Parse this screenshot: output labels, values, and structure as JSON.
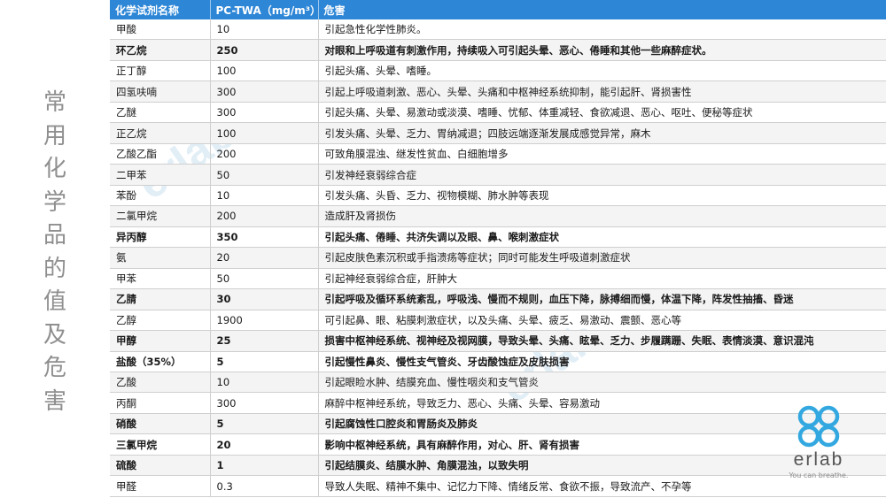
{
  "side_title": [
    "常",
    "用",
    "化",
    "学",
    "品",
    "的",
    "值",
    "及",
    "危",
    "害"
  ],
  "table": {
    "headers": [
      "化学试剂名称",
      "PC-TWA（mg/m³）",
      "危害"
    ],
    "rows": [
      {
        "name": "甲酸",
        "value": "10",
        "hazard": "引起急性化学性肺炎。",
        "bold": false
      },
      {
        "name": "环乙烷",
        "value": "250",
        "hazard": "对眼和上呼吸道有刺激作用，持续吸入可引起头晕、恶心、倦睡和其他一些麻醉症状。",
        "bold": true
      },
      {
        "name": "正丁醇",
        "value": "100",
        "hazard": "引起头痛、头晕、嗜睡。",
        "bold": false
      },
      {
        "name": "四氢呋喃",
        "value": "300",
        "hazard": "引起上呼吸道刺激、恶心、头晕、头痛和中枢神经系统抑制，能引起肝、肾损害性",
        "bold": false
      },
      {
        "name": "乙醚",
        "value": "300",
        "hazard": "引起头痛、头晕、易激动或淡漠、嗜睡、忧郁、体重减轻、食欲减退、恶心、呕吐、便秘等症状",
        "bold": false
      },
      {
        "name": "正乙烷",
        "value": "100",
        "hazard": "引发头痛、头晕、乏力、胃纳减退；四肢远端逐渐发展成感觉异常，麻木",
        "bold": false
      },
      {
        "name": "乙酸乙酯",
        "value": "200",
        "hazard": "可致角膜混浊、继发性贫血、白细胞增多",
        "bold": false
      },
      {
        "name": "二甲苯",
        "value": "50",
        "hazard": "引发神经衰弱综合症",
        "bold": false
      },
      {
        "name": "苯酚",
        "value": "10",
        "hazard": "引发头痛、头昏、乏力、视物模糊、肺水肿等表现",
        "bold": false
      },
      {
        "name": "二氯甲烷",
        "value": "200",
        "hazard": "造成肝及肾损伤",
        "bold": false
      },
      {
        "name": "异丙醇",
        "value": "350",
        "hazard": "引起头痛、倦睡、共济失调以及眼、鼻、喉刺激症状",
        "bold": true
      },
      {
        "name": "氨",
        "value": "20",
        "hazard": "引起皮肤色素沉积或手指溃疡等症状；同时可能发生呼吸道刺激症状",
        "bold": false
      },
      {
        "name": "甲苯",
        "value": "50",
        "hazard": "引起神经衰弱综合症，肝肿大",
        "bold": false
      },
      {
        "name": "乙腈",
        "value": "30",
        "hazard": "引起呼吸及循环系统紊乱，呼吸浅、慢而不规则，血压下降，脉搏细而慢，体温下降，阵发性抽搐、昏迷",
        "bold": true
      },
      {
        "name": "乙醇",
        "value": "1900",
        "hazard": "可引起鼻、眼、粘膜刺激症状，以及头痛、头晕、疲乏、易激动、震颤、恶心等",
        "bold": false
      },
      {
        "name": "甲醇",
        "value": "25",
        "hazard": "损害中枢神经系统、视神经及视网膜，导致头晕、头痛、眩晕、乏力、步履蹒跚、失眠、表情淡漠、意识混沌",
        "bold": true
      },
      {
        "name": "盐酸（35%）",
        "value": "5",
        "hazard": "引起慢性鼻炎、慢性支气管炎、牙齿酸蚀症及皮肤损害",
        "bold": true
      },
      {
        "name": "乙酸",
        "value": "10",
        "hazard": "引起眼睑水肿、结膜充血、慢性咽炎和支气管炎",
        "bold": false
      },
      {
        "name": "丙酮",
        "value": "300",
        "hazard": "麻醉中枢神经系统，导致乏力、恶心、头痛、头晕、容易激动",
        "bold": false
      },
      {
        "name": "硝酸",
        "value": "5",
        "hazard": "引起腐蚀性口腔炎和胃肠炎及肺炎",
        "bold": true
      },
      {
        "name": "三氯甲烷",
        "value": "20",
        "hazard": "影响中枢神经系统，具有麻醉作用，对心、肝、肾有损害",
        "bold": true
      },
      {
        "name": "硫酸",
        "value": "1",
        "hazard": "引起结膜炎、结膜水肿、角膜混浊，以致失明",
        "bold": true
      },
      {
        "name": "甲醛",
        "value": "0.3",
        "hazard": "导致人失眠、精神不集中、记忆力下降、情绪反常、食欲不振，导致流产、不孕等",
        "bold": false
      }
    ]
  },
  "logo": {
    "brand": "erlab",
    "tagline": "You can breathe.",
    "color": "#33a8e0"
  },
  "watermark": "erlab",
  "colors": {
    "header_bg": "#2d86d6",
    "side_title": "#8f8f8f"
  }
}
